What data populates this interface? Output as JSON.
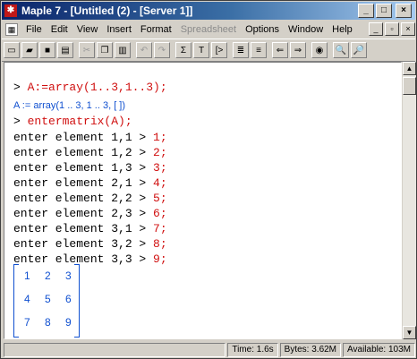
{
  "window": {
    "title": "Maple 7 - [Untitled (2) - [Server 1]]",
    "controls": [
      "_",
      "□",
      "×"
    ],
    "app_icon": "maple-leaf-icon"
  },
  "menubar": {
    "items": [
      {
        "label": "File",
        "disabled": false
      },
      {
        "label": "Edit",
        "disabled": false
      },
      {
        "label": "View",
        "disabled": false
      },
      {
        "label": "Insert",
        "disabled": false
      },
      {
        "label": "Format",
        "disabled": false
      },
      {
        "label": "Spreadsheet",
        "disabled": true
      },
      {
        "label": "Options",
        "disabled": false
      },
      {
        "label": "Window",
        "disabled": false
      },
      {
        "label": "Help",
        "disabled": false
      }
    ],
    "mdi_controls": [
      "_",
      "▫",
      "×"
    ]
  },
  "toolbar": {
    "buttons": [
      {
        "name": "new-icon",
        "glyph": "▭",
        "gray": false
      },
      {
        "name": "open-icon",
        "glyph": "▰",
        "gray": false
      },
      {
        "name": "save-icon",
        "glyph": "■",
        "gray": false
      },
      {
        "name": "print-icon",
        "glyph": "▤",
        "gray": false
      },
      {
        "name": "cut-icon",
        "glyph": "✂",
        "gray": true
      },
      {
        "name": "copy-icon",
        "glyph": "❐",
        "gray": false
      },
      {
        "name": "paste-icon",
        "glyph": "▥",
        "gray": false
      },
      {
        "name": "undo-icon",
        "glyph": "↶",
        "gray": true
      },
      {
        "name": "redo-icon",
        "glyph": "↷",
        "gray": true
      },
      {
        "name": "sigma-icon",
        "glyph": "Σ",
        "gray": false
      },
      {
        "name": "text-icon",
        "glyph": "T",
        "gray": false
      },
      {
        "name": "prompt-icon",
        "glyph": "[>",
        "gray": false
      },
      {
        "name": "indent-icon",
        "glyph": "≣",
        "gray": false
      },
      {
        "name": "outdent-icon",
        "glyph": "≡",
        "gray": false
      },
      {
        "name": "back-icon",
        "glyph": "⇐",
        "gray": false
      },
      {
        "name": "forward-icon",
        "glyph": "⇒",
        "gray": false
      },
      {
        "name": "stop-icon",
        "glyph": "◉",
        "gray": false
      },
      {
        "name": "zoom-in-icon",
        "glyph": "🔍",
        "gray": false
      },
      {
        "name": "zoom-out-icon",
        "glyph": "🔎",
        "gray": false
      }
    ]
  },
  "document": {
    "lines": [
      {
        "prompt": "> ",
        "text": "A:=array(1..3,1..3);",
        "style": "red"
      },
      {
        "prompt": "",
        "text": "A := array(1 .. 3, 1 .. 3, [ ])",
        "style": "blue"
      },
      {
        "prompt": "> ",
        "text": "entermatrix(A);",
        "style": "red"
      },
      {
        "prompt": "",
        "text": "enter element 1,1 > ",
        "tail": "1;",
        "style": "entry"
      },
      {
        "prompt": "",
        "text": "enter element 1,2 > ",
        "tail": "2;",
        "style": "entry"
      },
      {
        "prompt": "",
        "text": "enter element 1,3 > ",
        "tail": "3;",
        "style": "entry"
      },
      {
        "prompt": "",
        "text": "enter element 2,1 > ",
        "tail": "4;",
        "style": "entry"
      },
      {
        "prompt": "",
        "text": "enter element 2,2 > ",
        "tail": "5;",
        "style": "entry"
      },
      {
        "prompt": "",
        "text": "enter element 2,3 > ",
        "tail": "6;",
        "style": "entry"
      },
      {
        "prompt": "",
        "text": "enter element 3,1 > ",
        "tail": "7;",
        "style": "entry"
      },
      {
        "prompt": "",
        "text": "enter element 3,2 > ",
        "tail": "8;",
        "style": "entry"
      },
      {
        "prompt": "",
        "text": "enter element 3,3 > ",
        "tail": "9;",
        "style": "entry"
      }
    ],
    "matrix": [
      [
        "1",
        "2",
        "3"
      ],
      [
        "4",
        "5",
        "6"
      ],
      [
        "7",
        "8",
        "9"
      ]
    ]
  },
  "statusbar": {
    "time": "Time: 1.6s",
    "bytes": "Bytes: 3.62M",
    "available": "Available: 103M"
  },
  "colors": {
    "input_red": "#d01010",
    "output_blue": "#1050d0",
    "titlebar_start": "#0a246a"
  }
}
